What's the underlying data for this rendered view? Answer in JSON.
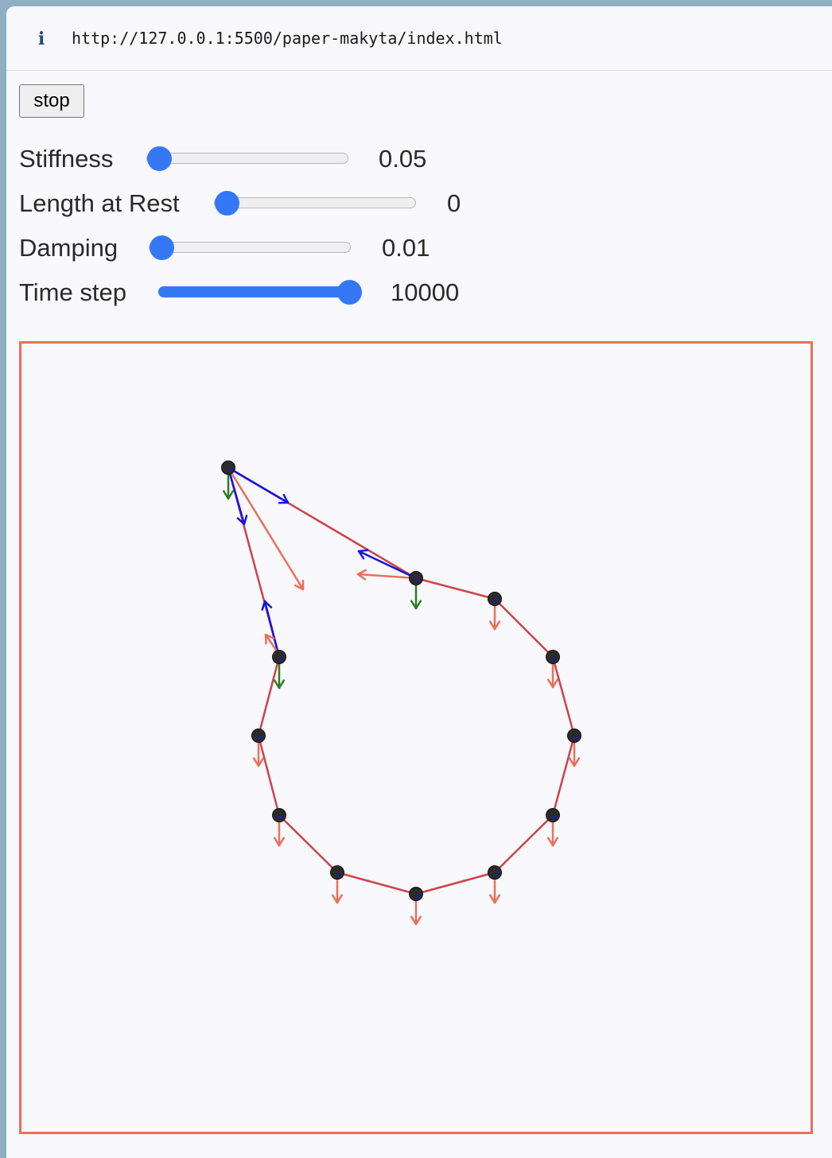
{
  "browser": {
    "url": "http://127.0.0.1:5500/paper-makyta/index.html",
    "info_icon": "info-icon"
  },
  "controls": {
    "toggle_button_label": "stop",
    "sliders": [
      {
        "label": "Stiffness",
        "value_text": "0.05",
        "fraction": 0.0
      },
      {
        "label": "Length at Rest",
        "value_text": "0",
        "fraction": 0.0
      },
      {
        "label": "Damping",
        "value_text": "0.01",
        "fraction": 0.0
      },
      {
        "label": "Time step",
        "value_text": "10000",
        "fraction": 1.0
      }
    ]
  },
  "simulation": {
    "colors": {
      "border": "#eb6f58",
      "spring": "#d0424c",
      "node": "#2b2b2b",
      "gravity_arrow": "#eb6f58",
      "spring_force_arrow": "#1414e0",
      "velocity_arrow": "#2e7d22"
    }
  }
}
